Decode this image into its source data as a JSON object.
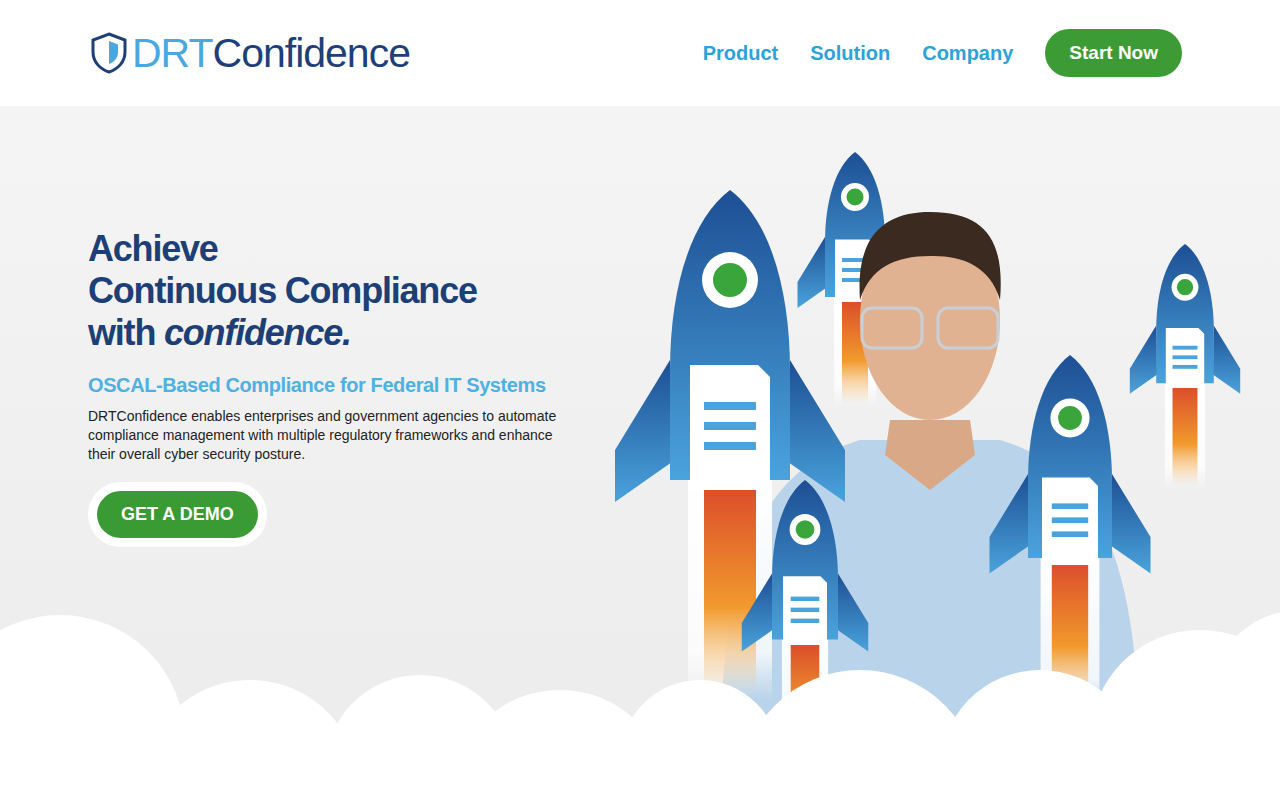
{
  "logo": {
    "prefix": "DRT",
    "name": "Confidence"
  },
  "nav": [
    {
      "label": "Product"
    },
    {
      "label": "Solution"
    },
    {
      "label": "Company"
    }
  ],
  "header_button": "Start Now",
  "hero": {
    "heading_lines": [
      "Achieve",
      "Continuous Compliance"
    ],
    "heading_last": "with",
    "heading_emphasis": "confidence.",
    "subtitle": "OSCAL-Based Compliance for Federal IT Systems",
    "description": "DRTConfidence enables enterprises and government agencies to automate compliance management with multiple regulatory frameworks and enhance their overall cyber security posture.",
    "button": "GET A DEMO"
  }
}
